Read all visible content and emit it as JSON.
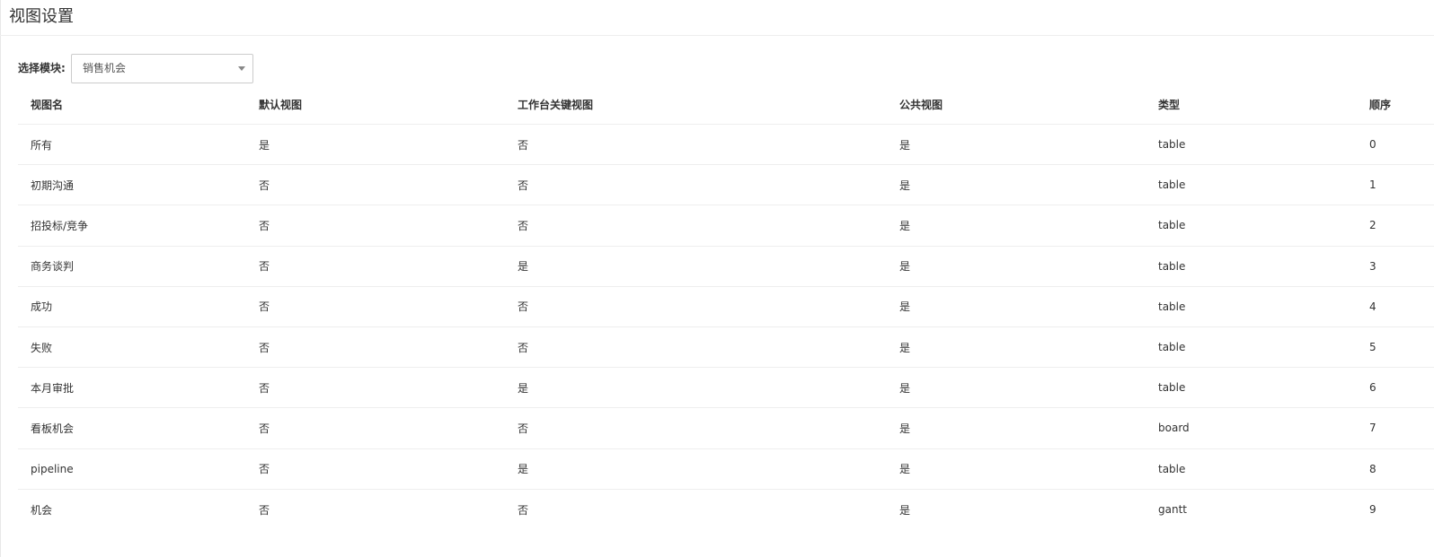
{
  "page": {
    "title": "视图设置"
  },
  "filter": {
    "label": "选择模块:",
    "selected": "销售机会"
  },
  "table": {
    "columns": [
      "视图名",
      "默认视图",
      "工作台关键视图",
      "公共视图",
      "类型",
      "顺序"
    ],
    "rows": [
      [
        "所有",
        "是",
        "否",
        "是",
        "table",
        "0"
      ],
      [
        "初期沟通",
        "否",
        "否",
        "是",
        "table",
        "1"
      ],
      [
        "招投标/竞争",
        "否",
        "否",
        "是",
        "table",
        "2"
      ],
      [
        "商务谈判",
        "否",
        "是",
        "是",
        "table",
        "3"
      ],
      [
        "成功",
        "否",
        "否",
        "是",
        "table",
        "4"
      ],
      [
        "失败",
        "否",
        "否",
        "是",
        "table",
        "5"
      ],
      [
        "本月审批",
        "否",
        "是",
        "是",
        "table",
        "6"
      ],
      [
        "看板机会",
        "否",
        "否",
        "是",
        "board",
        "7"
      ],
      [
        "pipeline",
        "否",
        "是",
        "是",
        "table",
        "8"
      ],
      [
        "机会",
        "否",
        "否",
        "是",
        "gantt",
        "9"
      ]
    ]
  }
}
